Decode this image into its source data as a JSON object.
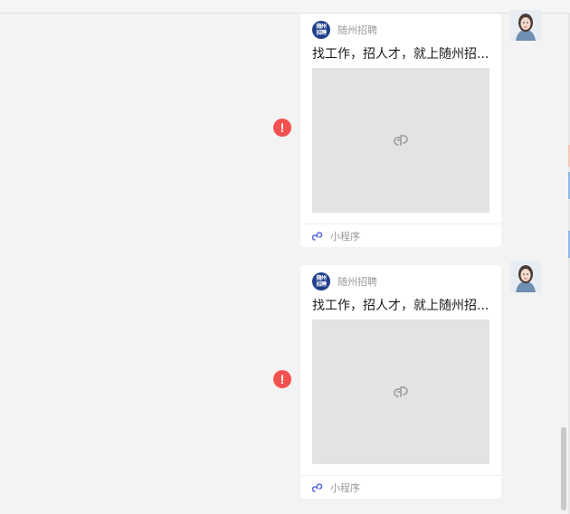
{
  "messages": [
    {
      "source_name": "随州招聘",
      "logo_text_line1": "随州",
      "logo_text_line2": "招聘",
      "title": "找工作，招人才，就上随州招...",
      "footer_label": "小程序",
      "status": "!"
    },
    {
      "source_name": "随州招聘",
      "logo_text_line1": "随州",
      "logo_text_line2": "招聘",
      "title": "找工作，招人才，就上随州招...",
      "footer_label": "小程序",
      "status": "!"
    }
  ],
  "colors": {
    "error": "#f25150",
    "mini_program_icon": "#5b6bdb",
    "placeholder_bg": "#e3e3e3",
    "logo_bg": "#1f3f8a"
  }
}
